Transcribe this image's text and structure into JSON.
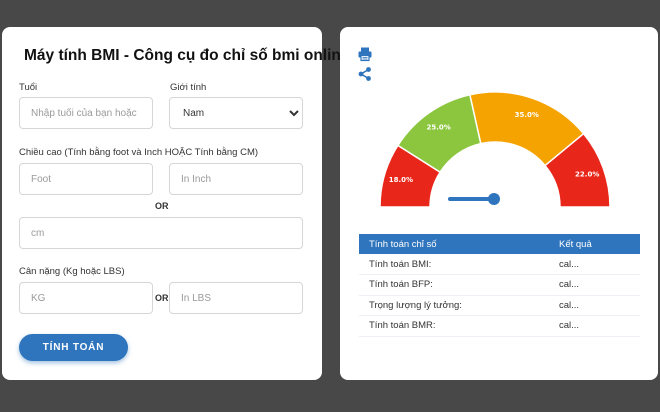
{
  "form": {
    "title": "Máy tính BMI - Công cụ đo chỉ số bmi online",
    "age": {
      "label": "Tuổi",
      "placeholder": "Nhập tuổi của bạn hoặc"
    },
    "gender": {
      "label": "Giới tính",
      "selected": "Nam"
    },
    "height": {
      "label": "Chiều cao (Tính bằng foot và Inch HOẶC Tính bằng CM)",
      "foot_placeholder": "Foot",
      "inch_placeholder": "In Inch",
      "or_label": "OR",
      "cm_placeholder": "cm"
    },
    "weight": {
      "label": "Cân nặng (Kg hoặc LBS)",
      "kg_placeholder": "KG",
      "or_label": "OR",
      "lbs_placeholder": "In LBS"
    },
    "submit_label": "TÍNH TOÁN"
  },
  "toolbar": {
    "icons": [
      "printer-icon",
      "share-icon"
    ]
  },
  "gauge": {
    "segments": [
      {
        "label": "18.0%",
        "value": 18,
        "color": "#e8261a"
      },
      {
        "label": "25.0%",
        "value": 25,
        "color": "#8cc63f"
      },
      {
        "label": "35.0%",
        "value": 35,
        "color": "#f5a300"
      },
      {
        "label": "22.0%",
        "value": 22,
        "color": "#e8261a"
      }
    ],
    "needle_color": "#2f75bd"
  },
  "results": {
    "headers": [
      "Tính toán chỉ số",
      "Kết quả"
    ],
    "rows": [
      [
        "Tính toán BMI:",
        "cal..."
      ],
      [
        "Tính toán BFP:",
        "cal..."
      ],
      [
        "Trọng lượng lý tưởng:",
        "cal..."
      ],
      [
        "Tính toán BMR:",
        "cal..."
      ]
    ]
  }
}
